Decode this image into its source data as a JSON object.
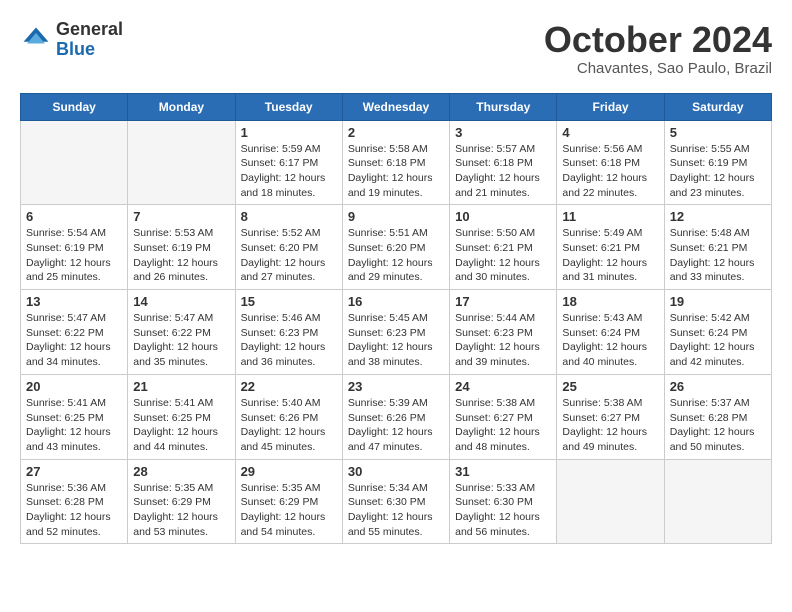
{
  "header": {
    "logo_line1": "General",
    "logo_line2": "Blue",
    "month": "October 2024",
    "location": "Chavantes, Sao Paulo, Brazil"
  },
  "days_of_week": [
    "Sunday",
    "Monday",
    "Tuesday",
    "Wednesday",
    "Thursday",
    "Friday",
    "Saturday"
  ],
  "weeks": [
    [
      {
        "day": "",
        "sunrise": "",
        "sunset": "",
        "daylight": "",
        "empty": true
      },
      {
        "day": "",
        "sunrise": "",
        "sunset": "",
        "daylight": "",
        "empty": true
      },
      {
        "day": "1",
        "sunrise": "Sunrise: 5:59 AM",
        "sunset": "Sunset: 6:17 PM",
        "daylight": "Daylight: 12 hours and 18 minutes.",
        "empty": false
      },
      {
        "day": "2",
        "sunrise": "Sunrise: 5:58 AM",
        "sunset": "Sunset: 6:18 PM",
        "daylight": "Daylight: 12 hours and 19 minutes.",
        "empty": false
      },
      {
        "day": "3",
        "sunrise": "Sunrise: 5:57 AM",
        "sunset": "Sunset: 6:18 PM",
        "daylight": "Daylight: 12 hours and 21 minutes.",
        "empty": false
      },
      {
        "day": "4",
        "sunrise": "Sunrise: 5:56 AM",
        "sunset": "Sunset: 6:18 PM",
        "daylight": "Daylight: 12 hours and 22 minutes.",
        "empty": false
      },
      {
        "day": "5",
        "sunrise": "Sunrise: 5:55 AM",
        "sunset": "Sunset: 6:19 PM",
        "daylight": "Daylight: 12 hours and 23 minutes.",
        "empty": false
      }
    ],
    [
      {
        "day": "6",
        "sunrise": "Sunrise: 5:54 AM",
        "sunset": "Sunset: 6:19 PM",
        "daylight": "Daylight: 12 hours and 25 minutes.",
        "empty": false
      },
      {
        "day": "7",
        "sunrise": "Sunrise: 5:53 AM",
        "sunset": "Sunset: 6:19 PM",
        "daylight": "Daylight: 12 hours and 26 minutes.",
        "empty": false
      },
      {
        "day": "8",
        "sunrise": "Sunrise: 5:52 AM",
        "sunset": "Sunset: 6:20 PM",
        "daylight": "Daylight: 12 hours and 27 minutes.",
        "empty": false
      },
      {
        "day": "9",
        "sunrise": "Sunrise: 5:51 AM",
        "sunset": "Sunset: 6:20 PM",
        "daylight": "Daylight: 12 hours and 29 minutes.",
        "empty": false
      },
      {
        "day": "10",
        "sunrise": "Sunrise: 5:50 AM",
        "sunset": "Sunset: 6:21 PM",
        "daylight": "Daylight: 12 hours and 30 minutes.",
        "empty": false
      },
      {
        "day": "11",
        "sunrise": "Sunrise: 5:49 AM",
        "sunset": "Sunset: 6:21 PM",
        "daylight": "Daylight: 12 hours and 31 minutes.",
        "empty": false
      },
      {
        "day": "12",
        "sunrise": "Sunrise: 5:48 AM",
        "sunset": "Sunset: 6:21 PM",
        "daylight": "Daylight: 12 hours and 33 minutes.",
        "empty": false
      }
    ],
    [
      {
        "day": "13",
        "sunrise": "Sunrise: 5:47 AM",
        "sunset": "Sunset: 6:22 PM",
        "daylight": "Daylight: 12 hours and 34 minutes.",
        "empty": false
      },
      {
        "day": "14",
        "sunrise": "Sunrise: 5:47 AM",
        "sunset": "Sunset: 6:22 PM",
        "daylight": "Daylight: 12 hours and 35 minutes.",
        "empty": false
      },
      {
        "day": "15",
        "sunrise": "Sunrise: 5:46 AM",
        "sunset": "Sunset: 6:23 PM",
        "daylight": "Daylight: 12 hours and 36 minutes.",
        "empty": false
      },
      {
        "day": "16",
        "sunrise": "Sunrise: 5:45 AM",
        "sunset": "Sunset: 6:23 PM",
        "daylight": "Daylight: 12 hours and 38 minutes.",
        "empty": false
      },
      {
        "day": "17",
        "sunrise": "Sunrise: 5:44 AM",
        "sunset": "Sunset: 6:23 PM",
        "daylight": "Daylight: 12 hours and 39 minutes.",
        "empty": false
      },
      {
        "day": "18",
        "sunrise": "Sunrise: 5:43 AM",
        "sunset": "Sunset: 6:24 PM",
        "daylight": "Daylight: 12 hours and 40 minutes.",
        "empty": false
      },
      {
        "day": "19",
        "sunrise": "Sunrise: 5:42 AM",
        "sunset": "Sunset: 6:24 PM",
        "daylight": "Daylight: 12 hours and 42 minutes.",
        "empty": false
      }
    ],
    [
      {
        "day": "20",
        "sunrise": "Sunrise: 5:41 AM",
        "sunset": "Sunset: 6:25 PM",
        "daylight": "Daylight: 12 hours and 43 minutes.",
        "empty": false
      },
      {
        "day": "21",
        "sunrise": "Sunrise: 5:41 AM",
        "sunset": "Sunset: 6:25 PM",
        "daylight": "Daylight: 12 hours and 44 minutes.",
        "empty": false
      },
      {
        "day": "22",
        "sunrise": "Sunrise: 5:40 AM",
        "sunset": "Sunset: 6:26 PM",
        "daylight": "Daylight: 12 hours and 45 minutes.",
        "empty": false
      },
      {
        "day": "23",
        "sunrise": "Sunrise: 5:39 AM",
        "sunset": "Sunset: 6:26 PM",
        "daylight": "Daylight: 12 hours and 47 minutes.",
        "empty": false
      },
      {
        "day": "24",
        "sunrise": "Sunrise: 5:38 AM",
        "sunset": "Sunset: 6:27 PM",
        "daylight": "Daylight: 12 hours and 48 minutes.",
        "empty": false
      },
      {
        "day": "25",
        "sunrise": "Sunrise: 5:38 AM",
        "sunset": "Sunset: 6:27 PM",
        "daylight": "Daylight: 12 hours and 49 minutes.",
        "empty": false
      },
      {
        "day": "26",
        "sunrise": "Sunrise: 5:37 AM",
        "sunset": "Sunset: 6:28 PM",
        "daylight": "Daylight: 12 hours and 50 minutes.",
        "empty": false
      }
    ],
    [
      {
        "day": "27",
        "sunrise": "Sunrise: 5:36 AM",
        "sunset": "Sunset: 6:28 PM",
        "daylight": "Daylight: 12 hours and 52 minutes.",
        "empty": false
      },
      {
        "day": "28",
        "sunrise": "Sunrise: 5:35 AM",
        "sunset": "Sunset: 6:29 PM",
        "daylight": "Daylight: 12 hours and 53 minutes.",
        "empty": false
      },
      {
        "day": "29",
        "sunrise": "Sunrise: 5:35 AM",
        "sunset": "Sunset: 6:29 PM",
        "daylight": "Daylight: 12 hours and 54 minutes.",
        "empty": false
      },
      {
        "day": "30",
        "sunrise": "Sunrise: 5:34 AM",
        "sunset": "Sunset: 6:30 PM",
        "daylight": "Daylight: 12 hours and 55 minutes.",
        "empty": false
      },
      {
        "day": "31",
        "sunrise": "Sunrise: 5:33 AM",
        "sunset": "Sunset: 6:30 PM",
        "daylight": "Daylight: 12 hours and 56 minutes.",
        "empty": false
      },
      {
        "day": "",
        "sunrise": "",
        "sunset": "",
        "daylight": "",
        "empty": true
      },
      {
        "day": "",
        "sunrise": "",
        "sunset": "",
        "daylight": "",
        "empty": true
      }
    ]
  ]
}
